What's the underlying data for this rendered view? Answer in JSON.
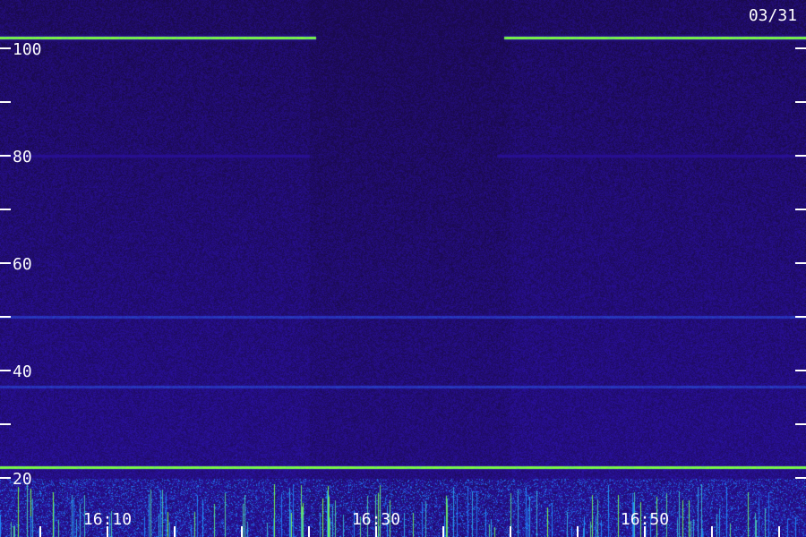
{
  "date_label": "03/31",
  "chart_data": {
    "type": "heatmap",
    "title": "",
    "xlabel": "",
    "ylabel": "",
    "x_range": [
      "16:02",
      "16:62"
    ],
    "x_tick_labels": [
      "16:10",
      "16:30",
      "16:50"
    ],
    "x_tick_values": [
      10,
      30,
      50
    ],
    "x_minor_step": 5,
    "y_range": [
      15,
      105
    ],
    "y_tick_labels": [
      "20",
      "40",
      "60",
      "80",
      "100"
    ],
    "y_tick_values": [
      20,
      40,
      60,
      80,
      100
    ],
    "y_minor_step": 10,
    "colors": {
      "background": "#1a0a4a",
      "low": "#2a10a0",
      "mid": "#1e90ff",
      "high": "#7fff3f",
      "text": "#ffffff"
    },
    "features": [
      {
        "kind": "band",
        "y": 102,
        "intensity": "high",
        "segments": [
          [
            2,
            25.5
          ],
          [
            39.5,
            62
          ]
        ]
      },
      {
        "kind": "band",
        "y": 80,
        "intensity": "low",
        "segments": [
          [
            2,
            25
          ],
          [
            39,
            62
          ]
        ]
      },
      {
        "kind": "band",
        "y": 50,
        "intensity": "mid-low",
        "segments": [
          [
            2,
            62
          ]
        ]
      },
      {
        "kind": "band",
        "y": 37,
        "intensity": "mid-low",
        "segments": [
          [
            2,
            62
          ]
        ]
      },
      {
        "kind": "band",
        "y": 22,
        "intensity": "high",
        "segments": [
          [
            2,
            62
          ]
        ]
      },
      {
        "kind": "noise-floor",
        "y_max": 20,
        "intensity": "mid-high",
        "segments": [
          [
            2,
            62
          ]
        ]
      }
    ]
  }
}
